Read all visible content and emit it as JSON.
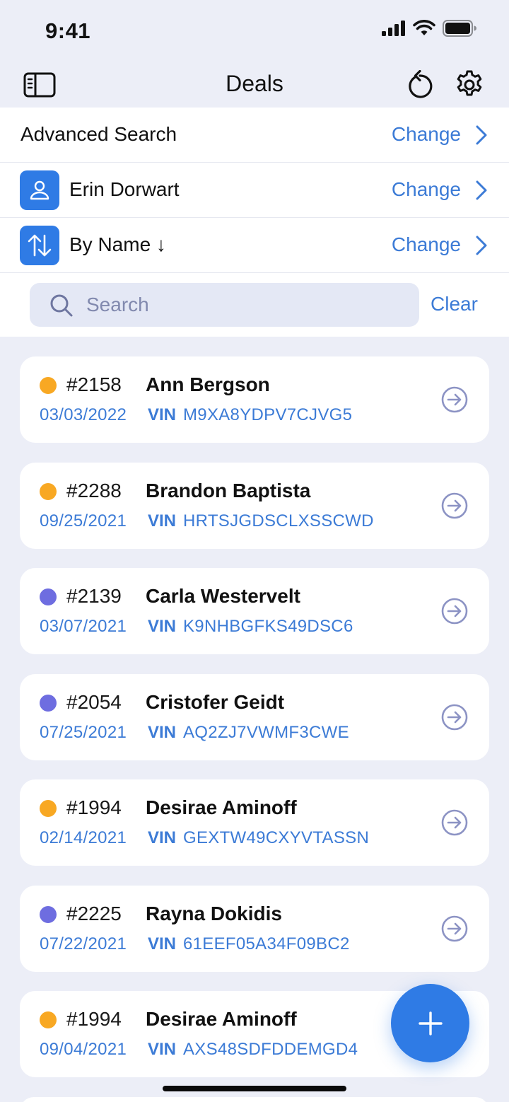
{
  "status_bar": {
    "time": "9:41"
  },
  "nav": {
    "title": "Deals"
  },
  "filters": {
    "advanced_search": {
      "label": "Advanced Search",
      "action": "Change"
    },
    "user": {
      "label": "Erin Dorwart",
      "action": "Change"
    },
    "sort": {
      "label": "By Name ↓",
      "action": "Change"
    }
  },
  "search": {
    "placeholder": "Search",
    "value": "",
    "clear_label": "Clear"
  },
  "colors": {
    "accent": "#2F7BE5",
    "link": "#3C7BD6",
    "status_orange": "#F8A823",
    "status_purple": "#6E6DE0"
  },
  "deals": [
    {
      "number": "#2158",
      "name": "Ann Bergson",
      "date": "03/03/2022",
      "vin_label": "VIN",
      "vin": "M9XA8YDPV7CJVG5",
      "status": "status_orange"
    },
    {
      "number": "#2288",
      "name": "Brandon Baptista",
      "date": "09/25/2021",
      "vin_label": "VIN",
      "vin": "HRTSJGDSCLXSSCWD",
      "status": "status_orange"
    },
    {
      "number": "#2139",
      "name": "Carla Westervelt",
      "date": "03/07/2021",
      "vin_label": "VIN",
      "vin": "K9NHBGFKS49DSC6",
      "status": "status_purple"
    },
    {
      "number": "#2054",
      "name": "Cristofer Geidt",
      "date": "07/25/2021",
      "vin_label": "VIN",
      "vin": "AQ2ZJ7VWMF3CWE",
      "status": "status_purple"
    },
    {
      "number": "#1994",
      "name": "Desirae Aminoff",
      "date": "02/14/2021",
      "vin_label": "VIN",
      "vin": "GEXTW49CXYVTASSN",
      "status": "status_orange"
    },
    {
      "number": "#2225",
      "name": "Rayna Dokidis",
      "date": "07/22/2021",
      "vin_label": "VIN",
      "vin": "61EEF05A34F09BC2",
      "status": "status_purple"
    },
    {
      "number": "#1994",
      "name": "Desirae Aminoff",
      "date": "09/04/2021",
      "vin_label": "VIN",
      "vin": "AXS48SDFDDEMGD4",
      "status": "status_orange"
    }
  ]
}
